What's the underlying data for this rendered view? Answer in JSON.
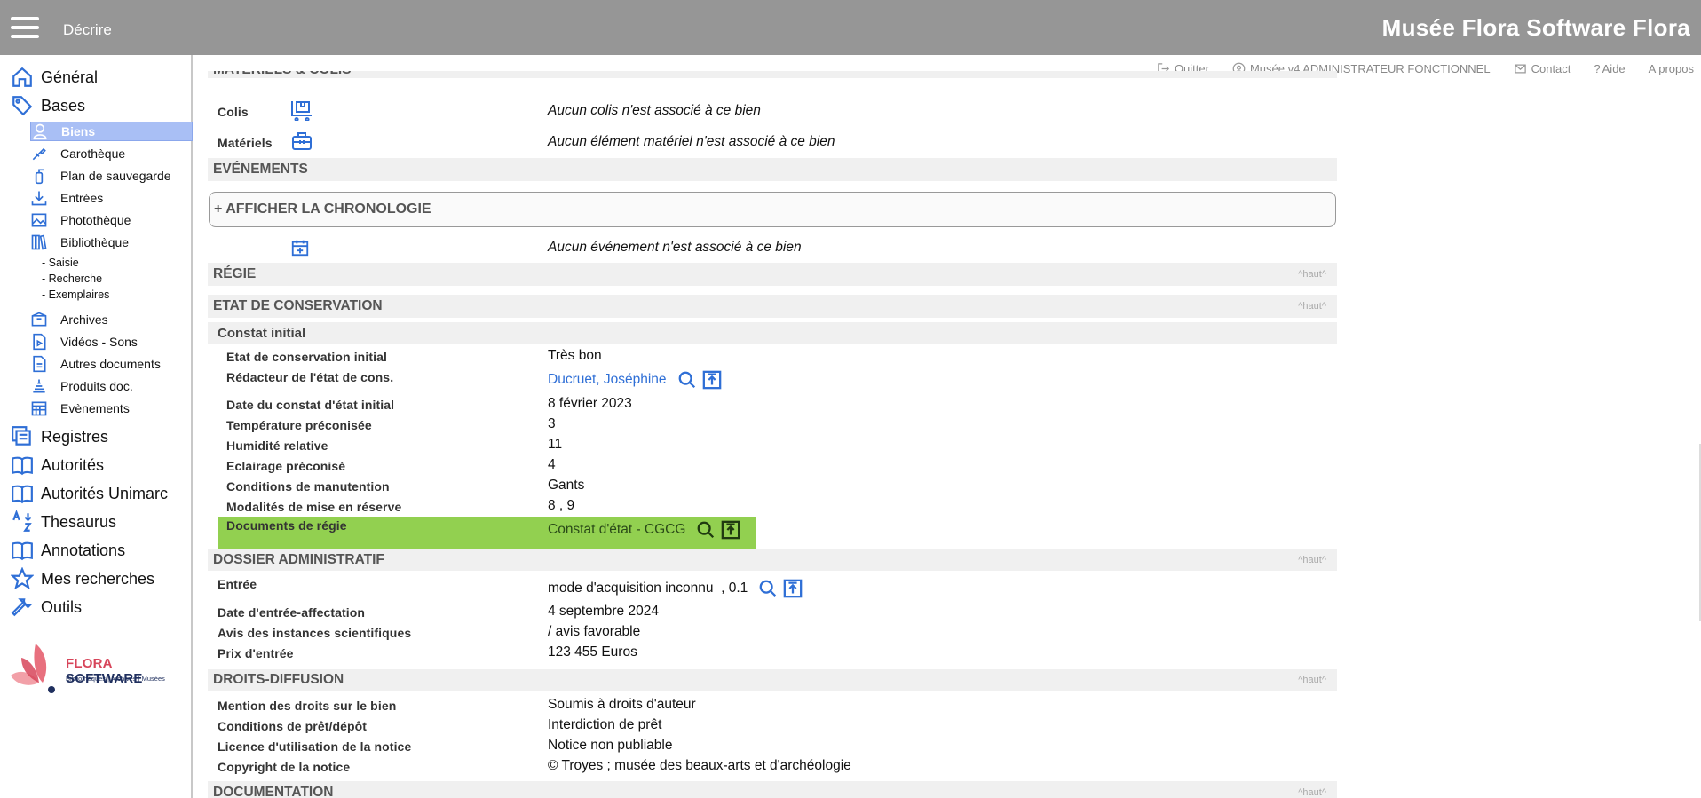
{
  "header": {
    "title": "Décrire",
    "brand": "Musée Flora Software Flora"
  },
  "utilbar": [
    {
      "name": "quit-link",
      "icon": "logout-icon",
      "label": "Quitter"
    },
    {
      "name": "user-link",
      "icon": "user-circle-icon",
      "label": "Musée v4 ADMINISTRATEUR FONCTIONNEL"
    },
    {
      "name": "contact-link",
      "icon": "mail-icon",
      "label": "Contact"
    },
    {
      "name": "help-link",
      "icon": "question-icon",
      "label": "Aide"
    },
    {
      "name": "about-link",
      "icon": "none",
      "label": "A propos"
    }
  ],
  "sidebar": {
    "general": "Général",
    "bases": "Bases",
    "biens": "Biens",
    "carotheque": "Carothèque",
    "plan": "Plan de sauvegarde",
    "entrees": "Entrées",
    "phototheque": "Photothèque",
    "bibliotheque": "Bibliothèque",
    "saisie": "- Saisie",
    "recherche": "- Recherche",
    "exemplaires": "- Exemplaires",
    "archives": "Archives",
    "videos": "Vidéos - Sons",
    "autres": "Autres documents",
    "produits": "Produits doc.",
    "evenements": "Evènements",
    "registres": "Registres",
    "autorites": "Autorités",
    "autorites_unimarc": "Autorités Unimarc",
    "thesaurus": "Thesaurus",
    "annotations": "Annotations",
    "mes_recherches": "Mes recherches",
    "outils": "Outils"
  },
  "logo": {
    "brand_part1": "FLORA",
    "brand_part2": "SOFTWARE",
    "tagline": "Bibliothèques | Archives | Musées"
  },
  "content": {
    "partial_top": "MATÉRIELS & COLIS",
    "colis_label": "Colis",
    "colis_value": "Aucun colis n'est associé à ce bien",
    "materiels_label": "Matériels",
    "materiels_value": "Aucun élément matériel n'est associé à ce bien",
    "evenements_section": "EVÉNEMENTS",
    "chrono_button": "+ AFFICHER LA CHRONOLOGIE",
    "evenement_value": "Aucun événement n'est associé à ce bien",
    "regie_section": "RÉGIE",
    "etat_section": "ETAT DE CONSERVATION",
    "constat_subhead": "Constat initial",
    "haut_label": "^haut^",
    "etat_fields": [
      {
        "label": "Etat de conservation initial",
        "value": "Très bon"
      },
      {
        "label": "Rédacteur de l'état de cons.",
        "value": "Ducruet, Joséphine"
      },
      {
        "label": "Date du constat d'état initial",
        "value": "8 février 2023"
      },
      {
        "label": "Température préconisée",
        "value": "3"
      },
      {
        "label": "Humidité relative",
        "value": "11"
      },
      {
        "label": "Eclairage préconisé",
        "value": "4"
      },
      {
        "label": "Conditions de manutention",
        "value": "Gants"
      },
      {
        "label": "Modalités de mise en réserve",
        "value": "8 , 9"
      },
      {
        "label": "Documents de régie",
        "value": "Constat d'état - CGCG"
      }
    ],
    "dossier_section": "DOSSIER ADMINISTRATIF",
    "dossier_fields": [
      {
        "label": "Entrée",
        "value": "mode d'acquisition inconnu  , 0.1"
      },
      {
        "label": "Date d'entrée-affectation",
        "value": "4 septembre 2024"
      },
      {
        "label": "Avis des instances scientifiques",
        "value": "/ avis favorable"
      },
      {
        "label": "Prix d'entrée",
        "value": "123 455 Euros"
      }
    ],
    "droits_section": "DROITS-DIFFUSION",
    "droits_fields": [
      {
        "label": "Mention des droits sur le bien",
        "value": "Soumis à droits d'auteur"
      },
      {
        "label": "Conditions de prêt/dépôt",
        "value": "Interdiction de prêt"
      },
      {
        "label": "Licence d'utilisation de la notice",
        "value": "Notice non publiable"
      },
      {
        "label": "Copyright de la notice",
        "value": "© Troyes ; musée des beaux-arts et d'archéologie"
      }
    ],
    "documentation_section": "DOCUMENTATION"
  },
  "colors": {
    "topbar": "#969696",
    "active_nav": "#a9bff5",
    "highlight": "#92d050",
    "link": "#2f6fd6",
    "icon_blue": "#2f6fd6"
  }
}
